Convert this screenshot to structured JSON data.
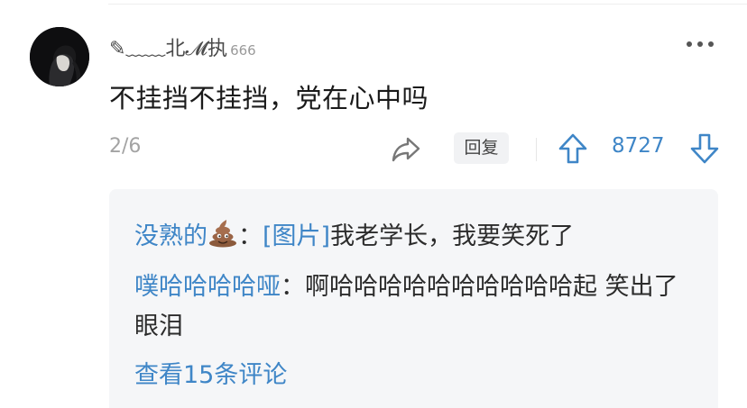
{
  "comment": {
    "username": "✎﹏﹏北𝓜执",
    "user_level": "666",
    "text": "不挂挡不挂挡，党在心中吗",
    "counter": "2/6",
    "reply_label": "回复",
    "vote_count": "8727",
    "icons": [
      "more-icon",
      "share-icon",
      "upvote-icon",
      "downvote-icon"
    ]
  },
  "replies": {
    "items": [
      {
        "name": "没熟的",
        "emoji": "poop-emoji",
        "separator": "：",
        "image_tag": "[图片]",
        "text": "我老学长，我要笑死了"
      },
      {
        "name": "噗哈哈哈哈哑",
        "separator": "：",
        "text": "啊哈哈哈哈哈哈哈哈哈哈起 笑出了眼泪"
      }
    ],
    "view_all": "查看15条评论"
  },
  "colors": {
    "accent": "#3f86c7",
    "reply_bg": "#f5f6f8",
    "muted": "#a3a3a3"
  }
}
